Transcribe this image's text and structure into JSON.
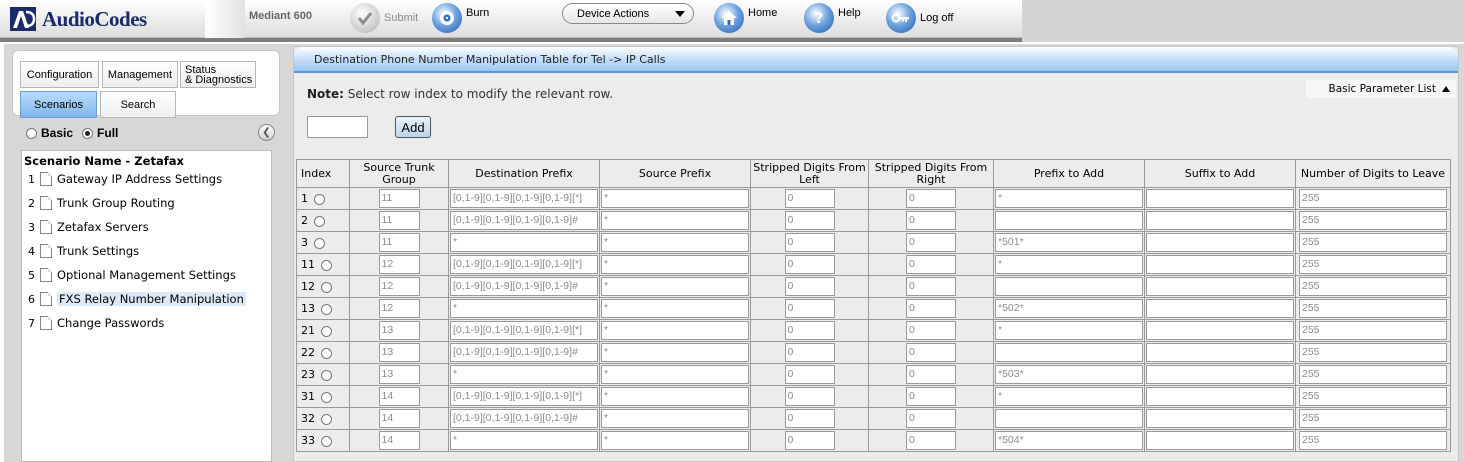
{
  "app": {
    "logo_text": "AudioCodes",
    "model": "Mediant 600"
  },
  "toolbar": {
    "submit_label": "Submit",
    "burn_label": "Burn",
    "device_actions_label": "Device Actions",
    "home_label": "Home",
    "help_label": "Help",
    "logoff_label": "Log off"
  },
  "nav_tabs": {
    "configuration": "Configuration",
    "management": "Management",
    "status_line1": "Status",
    "status_line2": "& Diagnostics",
    "scenarios": "Scenarios",
    "search": "Search"
  },
  "mode": {
    "basic": "Basic",
    "full": "Full",
    "selected": "Full"
  },
  "scenario": {
    "title": "Scenario Name - Zetafax",
    "items": [
      {
        "num": "1",
        "label": "Gateway IP Address Settings"
      },
      {
        "num": "2",
        "label": "Trunk Group Routing"
      },
      {
        "num": "3",
        "label": "Zetafax Servers"
      },
      {
        "num": "4",
        "label": "Trunk Settings"
      },
      {
        "num": "5",
        "label": "Optional Management Settings"
      },
      {
        "num": "6",
        "label": "FXS Relay Number Manipulation",
        "active": true
      },
      {
        "num": "7",
        "label": "Change Passwords"
      }
    ]
  },
  "page": {
    "title": "Destination Phone Number Manipulation Table for Tel -> IP Calls",
    "note_bold": "Note:",
    "note_text": " Select row index to modify the relevant row.",
    "param_list_label": "Basic Parameter List",
    "add_label": "Add",
    "add_index_value": ""
  },
  "table": {
    "headers": {
      "index": "Index",
      "source_trunk_group": "Source Trunk Group",
      "destination_prefix": "Destination Prefix",
      "source_prefix": "Source Prefix",
      "stripped_left": "Stripped Digits From Left",
      "stripped_right": "Stripped Digits From Right",
      "prefix_to_add": "Prefix to Add",
      "suffix_to_add": "Suffix to Add",
      "digits_to_leave": "Number of Digits to Leave"
    },
    "rows": [
      {
        "index": "1",
        "trunk": "11",
        "dest_prefix": "[0,1-9][0,1-9][0,1-9][0,1-9][*]",
        "src_prefix": "*",
        "strip_left": "0",
        "strip_right": "0",
        "prefix_add": "*",
        "suffix_add": "",
        "digits_leave": "255"
      },
      {
        "index": "2",
        "trunk": "11",
        "dest_prefix": "[0,1-9][0,1-9][0,1-9][0,1-9]#",
        "src_prefix": "*",
        "strip_left": "0",
        "strip_right": "0",
        "prefix_add": "",
        "suffix_add": "",
        "digits_leave": "255"
      },
      {
        "index": "3",
        "trunk": "11",
        "dest_prefix": "*",
        "src_prefix": "*",
        "strip_left": "0",
        "strip_right": "0",
        "prefix_add": "*501*",
        "suffix_add": "",
        "digits_leave": "255"
      },
      {
        "index": "11",
        "trunk": "12",
        "dest_prefix": "[0,1-9][0,1-9][0,1-9][0,1-9][*]",
        "src_prefix": "*",
        "strip_left": "0",
        "strip_right": "0",
        "prefix_add": "*",
        "suffix_add": "",
        "digits_leave": "255"
      },
      {
        "index": "12",
        "trunk": "12",
        "dest_prefix": "[0,1-9][0,1-9][0,1-9][0,1-9]#",
        "src_prefix": "*",
        "strip_left": "0",
        "strip_right": "0",
        "prefix_add": "",
        "suffix_add": "",
        "digits_leave": "255"
      },
      {
        "index": "13",
        "trunk": "12",
        "dest_prefix": "*",
        "src_prefix": "*",
        "strip_left": "0",
        "strip_right": "0",
        "prefix_add": "*502*",
        "suffix_add": "",
        "digits_leave": "255"
      },
      {
        "index": "21",
        "trunk": "13",
        "dest_prefix": "[0,1-9][0,1-9][0,1-9][0,1-9][*]",
        "src_prefix": "*",
        "strip_left": "0",
        "strip_right": "0",
        "prefix_add": "*",
        "suffix_add": "",
        "digits_leave": "255"
      },
      {
        "index": "22",
        "trunk": "13",
        "dest_prefix": "[0,1-9][0,1-9][0,1-9][0,1-9]#",
        "src_prefix": "*",
        "strip_left": "0",
        "strip_right": "0",
        "prefix_add": "",
        "suffix_add": "",
        "digits_leave": "255"
      },
      {
        "index": "23",
        "trunk": "13",
        "dest_prefix": "*",
        "src_prefix": "*",
        "strip_left": "0",
        "strip_right": "0",
        "prefix_add": "*503*",
        "suffix_add": "",
        "digits_leave": "255"
      },
      {
        "index": "31",
        "trunk": "14",
        "dest_prefix": "[0,1-9][0,1-9][0,1-9][0,1-9][*]",
        "src_prefix": "*",
        "strip_left": "0",
        "strip_right": "0",
        "prefix_add": "*",
        "suffix_add": "",
        "digits_leave": "255"
      },
      {
        "index": "32",
        "trunk": "14",
        "dest_prefix": "[0,1-9][0,1-9][0,1-9][0,1-9]#",
        "src_prefix": "*",
        "strip_left": "0",
        "strip_right": "0",
        "prefix_add": "",
        "suffix_add": "",
        "digits_leave": "255"
      },
      {
        "index": "33",
        "trunk": "14",
        "dest_prefix": "*",
        "src_prefix": "*",
        "strip_left": "0",
        "strip_right": "0",
        "prefix_add": "*504*",
        "suffix_add": "",
        "digits_leave": "255"
      }
    ]
  },
  "icons": {
    "logo": "audiocodes-logo-icon",
    "submit": "checkmark-icon",
    "burn": "burn-disc-icon",
    "home": "home-icon",
    "help": "question-mark-icon",
    "logoff": "key-icon",
    "collapse": "chevron-left-icon",
    "document": "document-icon"
  },
  "colors": {
    "logo_blue": "#1a2a6b",
    "header_blue": "#9cc7f1",
    "scenarios_tab": "#7fb6ec",
    "panel_grey": "#d7d7d7",
    "disabled_text": "#8c8c8c"
  }
}
